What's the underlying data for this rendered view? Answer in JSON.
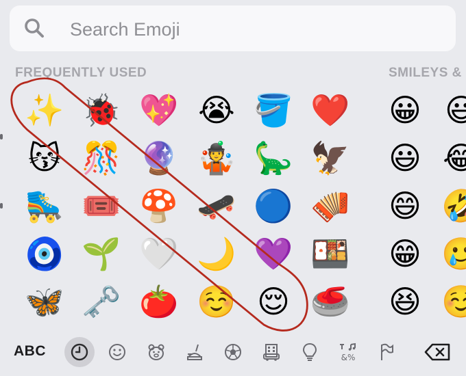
{
  "search": {
    "placeholder": "Search Emoji",
    "icon": "search-icon"
  },
  "sections": [
    {
      "title": "FREQUENTLY USED"
    },
    {
      "title": "SMILEYS &"
    }
  ],
  "frequently_used": [
    [
      "✨",
      "🐞",
      "💖",
      "😭",
      "🪣",
      "❤️"
    ],
    [
      "😽",
      "🎊",
      "🔮",
      "🤹",
      "🦕",
      "🦅"
    ],
    [
      "🛼",
      "🎟️",
      "🍄",
      "🛹",
      "🔵",
      "🪗"
    ],
    [
      "🧿",
      "🌱",
      "🤍",
      "🌙",
      "💜",
      "🍱"
    ],
    [
      "🦋",
      "🗝️",
      "🍅",
      "☺️",
      "😌",
      "🥌"
    ]
  ],
  "smileys_partial": [
    [
      "😀",
      "😃"
    ],
    [
      "😃",
      "😂"
    ],
    [
      "😄",
      "🤣"
    ],
    [
      "😁",
      "🥲"
    ],
    [
      "😆",
      "☺️"
    ]
  ],
  "annotation": {
    "color": "#b52a1e"
  },
  "category_bar": {
    "abc_label": "ABC",
    "icons": [
      "recent-clock-icon",
      "smiley-icon",
      "animal-icon",
      "food-icon",
      "sports-ball-icon",
      "travel-icon",
      "lightbulb-icon",
      "symbols-icon",
      "flag-icon",
      "delete-icon"
    ],
    "selected": "recent-clock-icon",
    "symbols_text": "&%"
  }
}
